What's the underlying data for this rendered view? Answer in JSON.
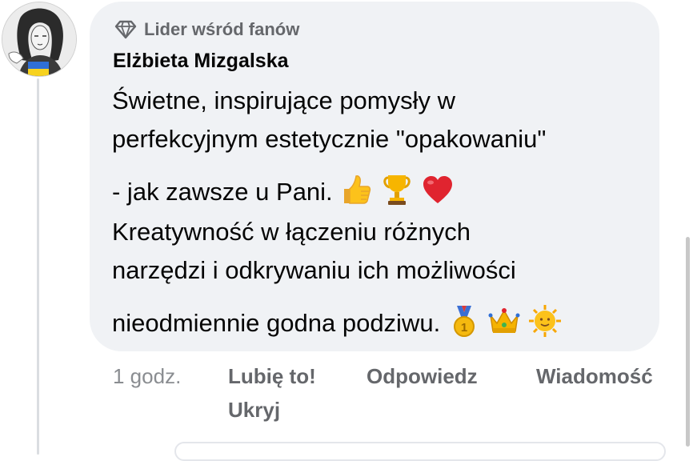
{
  "comment": {
    "badge_icon": "diamond-icon",
    "badge_label": "Lider wśród fanów",
    "author": "Elżbieta Mizgalska",
    "lines": [
      "Świetne, inspirujące pomysły w",
      "perfekcyjnym estetycznie \"opakowaniu\"",
      "- jak zawsze u Pani.",
      "Kreatywność w łączeniu różnych",
      "narzędzi i odkrywaniu ich możliwości",
      "nieodmiennie godna podziwu."
    ],
    "emojis_line3": [
      "thumbs-up-icon",
      "trophy-icon",
      "red-heart-icon"
    ],
    "emojis_line6": [
      "first-place-medal-icon",
      "crown-icon",
      "sun-with-face-icon"
    ]
  },
  "actions": {
    "time": "1 godz.",
    "like": "Lubię to!",
    "reply": "Odpowiedz",
    "message": "Wiadomość",
    "hide": "Ukryj"
  },
  "colors": {
    "bubble": "#f0f2f5",
    "secondary_text": "#65676b",
    "primary_text": "#050505"
  }
}
